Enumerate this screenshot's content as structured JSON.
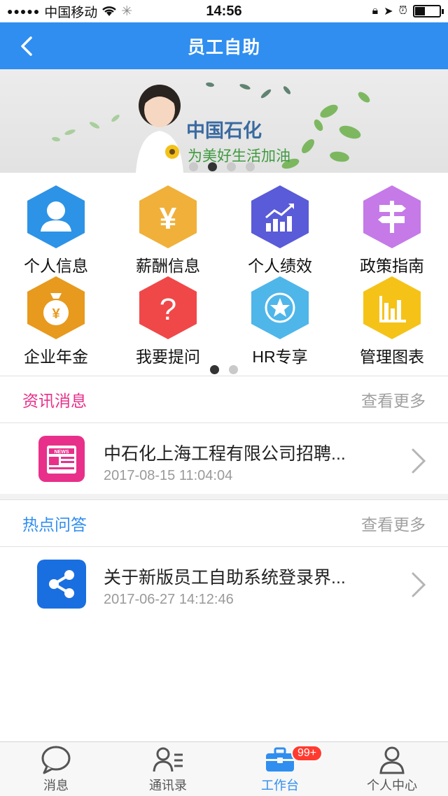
{
  "status_bar": {
    "carrier": "中国移动",
    "time": "14:56"
  },
  "nav": {
    "title": "员工自助"
  },
  "banner": {
    "title": "中国石化",
    "slogan": "为美好生活加油"
  },
  "grid": {
    "items": [
      {
        "label": "个人信息",
        "icon": "person-icon",
        "color": "#2d93e6"
      },
      {
        "label": "薪酬信息",
        "icon": "yen-icon",
        "color": "#f0b03a"
      },
      {
        "label": "个人绩效",
        "icon": "chart-trend-icon",
        "color": "#5a5bd8"
      },
      {
        "label": "政策指南",
        "icon": "signpost-icon",
        "color": "#c57ae8"
      },
      {
        "label": "企业年金",
        "icon": "money-bag-icon",
        "color": "#e79a1d"
      },
      {
        "label": "我要提问",
        "icon": "question-icon",
        "color": "#f04848"
      },
      {
        "label": "HR专享",
        "icon": "star-icon",
        "color": "#4fb6ea"
      },
      {
        "label": "管理图表",
        "icon": "bar-chart-icon",
        "color": "#f5c318"
      }
    ]
  },
  "news_section": {
    "title": "资讯消息",
    "more": "查看更多",
    "title_color": "#e8308a",
    "item": {
      "title": "中石化上海工程有限公司招聘...",
      "date": "2017-08-15 11:04:04",
      "icon": "news-icon"
    }
  },
  "qa_section": {
    "title": "热点问答",
    "more": "查看更多",
    "title_color": "#2f8ef0",
    "item": {
      "title": "关于新版员工自助系统登录界...",
      "date": "2017-06-27 14:12:46",
      "icon": "share-icon"
    }
  },
  "tab_bar": {
    "tabs": [
      {
        "label": "消息",
        "icon": "chat-bubble-icon"
      },
      {
        "label": "通讯录",
        "icon": "contacts-icon"
      },
      {
        "label": "工作台",
        "icon": "briefcase-icon",
        "badge": "99+"
      },
      {
        "label": "个人中心",
        "icon": "user-icon"
      }
    ]
  }
}
